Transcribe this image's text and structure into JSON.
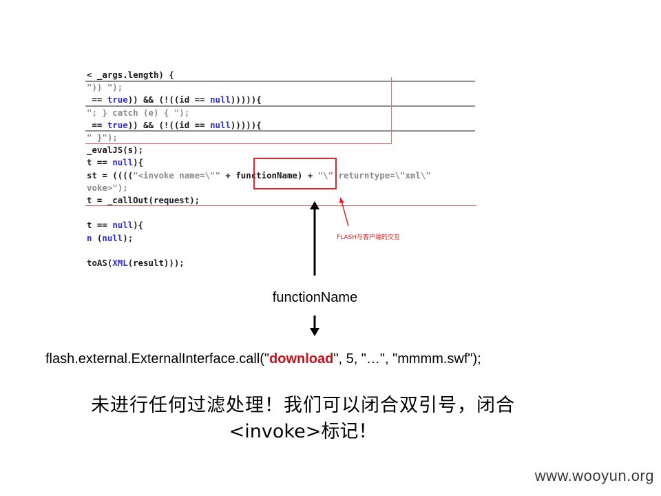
{
  "code_screenshot": {
    "lines": [
      [
        {
          "t": "t",
          "v": "< _args.length) {"
        }
      ],
      [
        {
          "t": "s",
          "v": "\")) \");"
        }
      ],
      [
        {
          "t": "t",
          "v": " == "
        },
        {
          "t": "k",
          "v": "true"
        },
        {
          "t": "t",
          "v": ")) && (!(("
        },
        {
          "t": "t",
          "v": "id"
        },
        {
          "t": "t",
          "v": " == "
        },
        {
          "t": "k",
          "v": "null"
        },
        {
          "t": "t",
          "v": "))))){"
        }
      ],
      [
        {
          "t": "s",
          "v": "\"; } catch (e) { \");"
        }
      ],
      [
        {
          "t": "t",
          "v": " == "
        },
        {
          "t": "k",
          "v": "true"
        },
        {
          "t": "t",
          "v": ")) && (!(("
        },
        {
          "t": "t",
          "v": "id"
        },
        {
          "t": "t",
          "v": " == "
        },
        {
          "t": "k",
          "v": "null"
        },
        {
          "t": "t",
          "v": "))))){"
        }
      ],
      [
        {
          "t": "s",
          "v": "\" }\");"
        }
      ],
      [
        {
          "t": "t",
          "v": "_evalJS(s);"
        }
      ],
      [
        {
          "t": "t",
          "v": "t == "
        },
        {
          "t": "k",
          "v": "null"
        },
        {
          "t": "t",
          "v": "){"
        }
      ],
      [
        {
          "t": "t",
          "v": "st = (((("
        },
        {
          "t": "s",
          "v": "\"<invoke name=\\\"\" "
        },
        {
          "t": "t",
          "v": "+ functionName) + "
        },
        {
          "t": "s",
          "v": "\"\\\" returntype=\\\"xml\\\""
        }
      ],
      [
        {
          "t": "s",
          "v": "voke>\");"
        }
      ],
      [
        {
          "t": "t",
          "v": "t = _callOut(request);"
        }
      ],
      [
        {
          "t": "t",
          "v": ""
        }
      ],
      [
        {
          "t": "t",
          "v": "t == "
        },
        {
          "t": "k",
          "v": "null"
        },
        {
          "t": "t",
          "v": "){"
        }
      ],
      [
        {
          "t": "k",
          "v": "n"
        },
        {
          "t": "t",
          "v": " ("
        },
        {
          "t": "k",
          "v": "null"
        },
        {
          "t": "t",
          "v": ");"
        }
      ],
      [
        {
          "t": "t",
          "v": ""
        }
      ],
      [
        {
          "t": "t",
          "v": "toAS("
        },
        {
          "t": "k",
          "v": "XML"
        },
        {
          "t": "t",
          "v": "(result)));"
        }
      ]
    ],
    "annotation": "FLASH与客户端的交互"
  },
  "function_name_label": "functionName",
  "call_example": {
    "before": "flash.external.ExternalInterface.call(\"",
    "highlight": "download",
    "after": "\", 5, \"…\", \"mmmm.swf\");"
  },
  "chinese_text": {
    "line1": "未进行任何过滤处理！我们可以闭合双引号，闭合",
    "line2": "<invoke>标记！"
  },
  "watermark": "www.wooyun.org",
  "colors": {
    "highlight_red": "#c0121a",
    "box_red": "#e8202a"
  },
  "icons": [
    "arrow-up-icon",
    "arrow-down-icon",
    "annotation-arrow-icon"
  ]
}
